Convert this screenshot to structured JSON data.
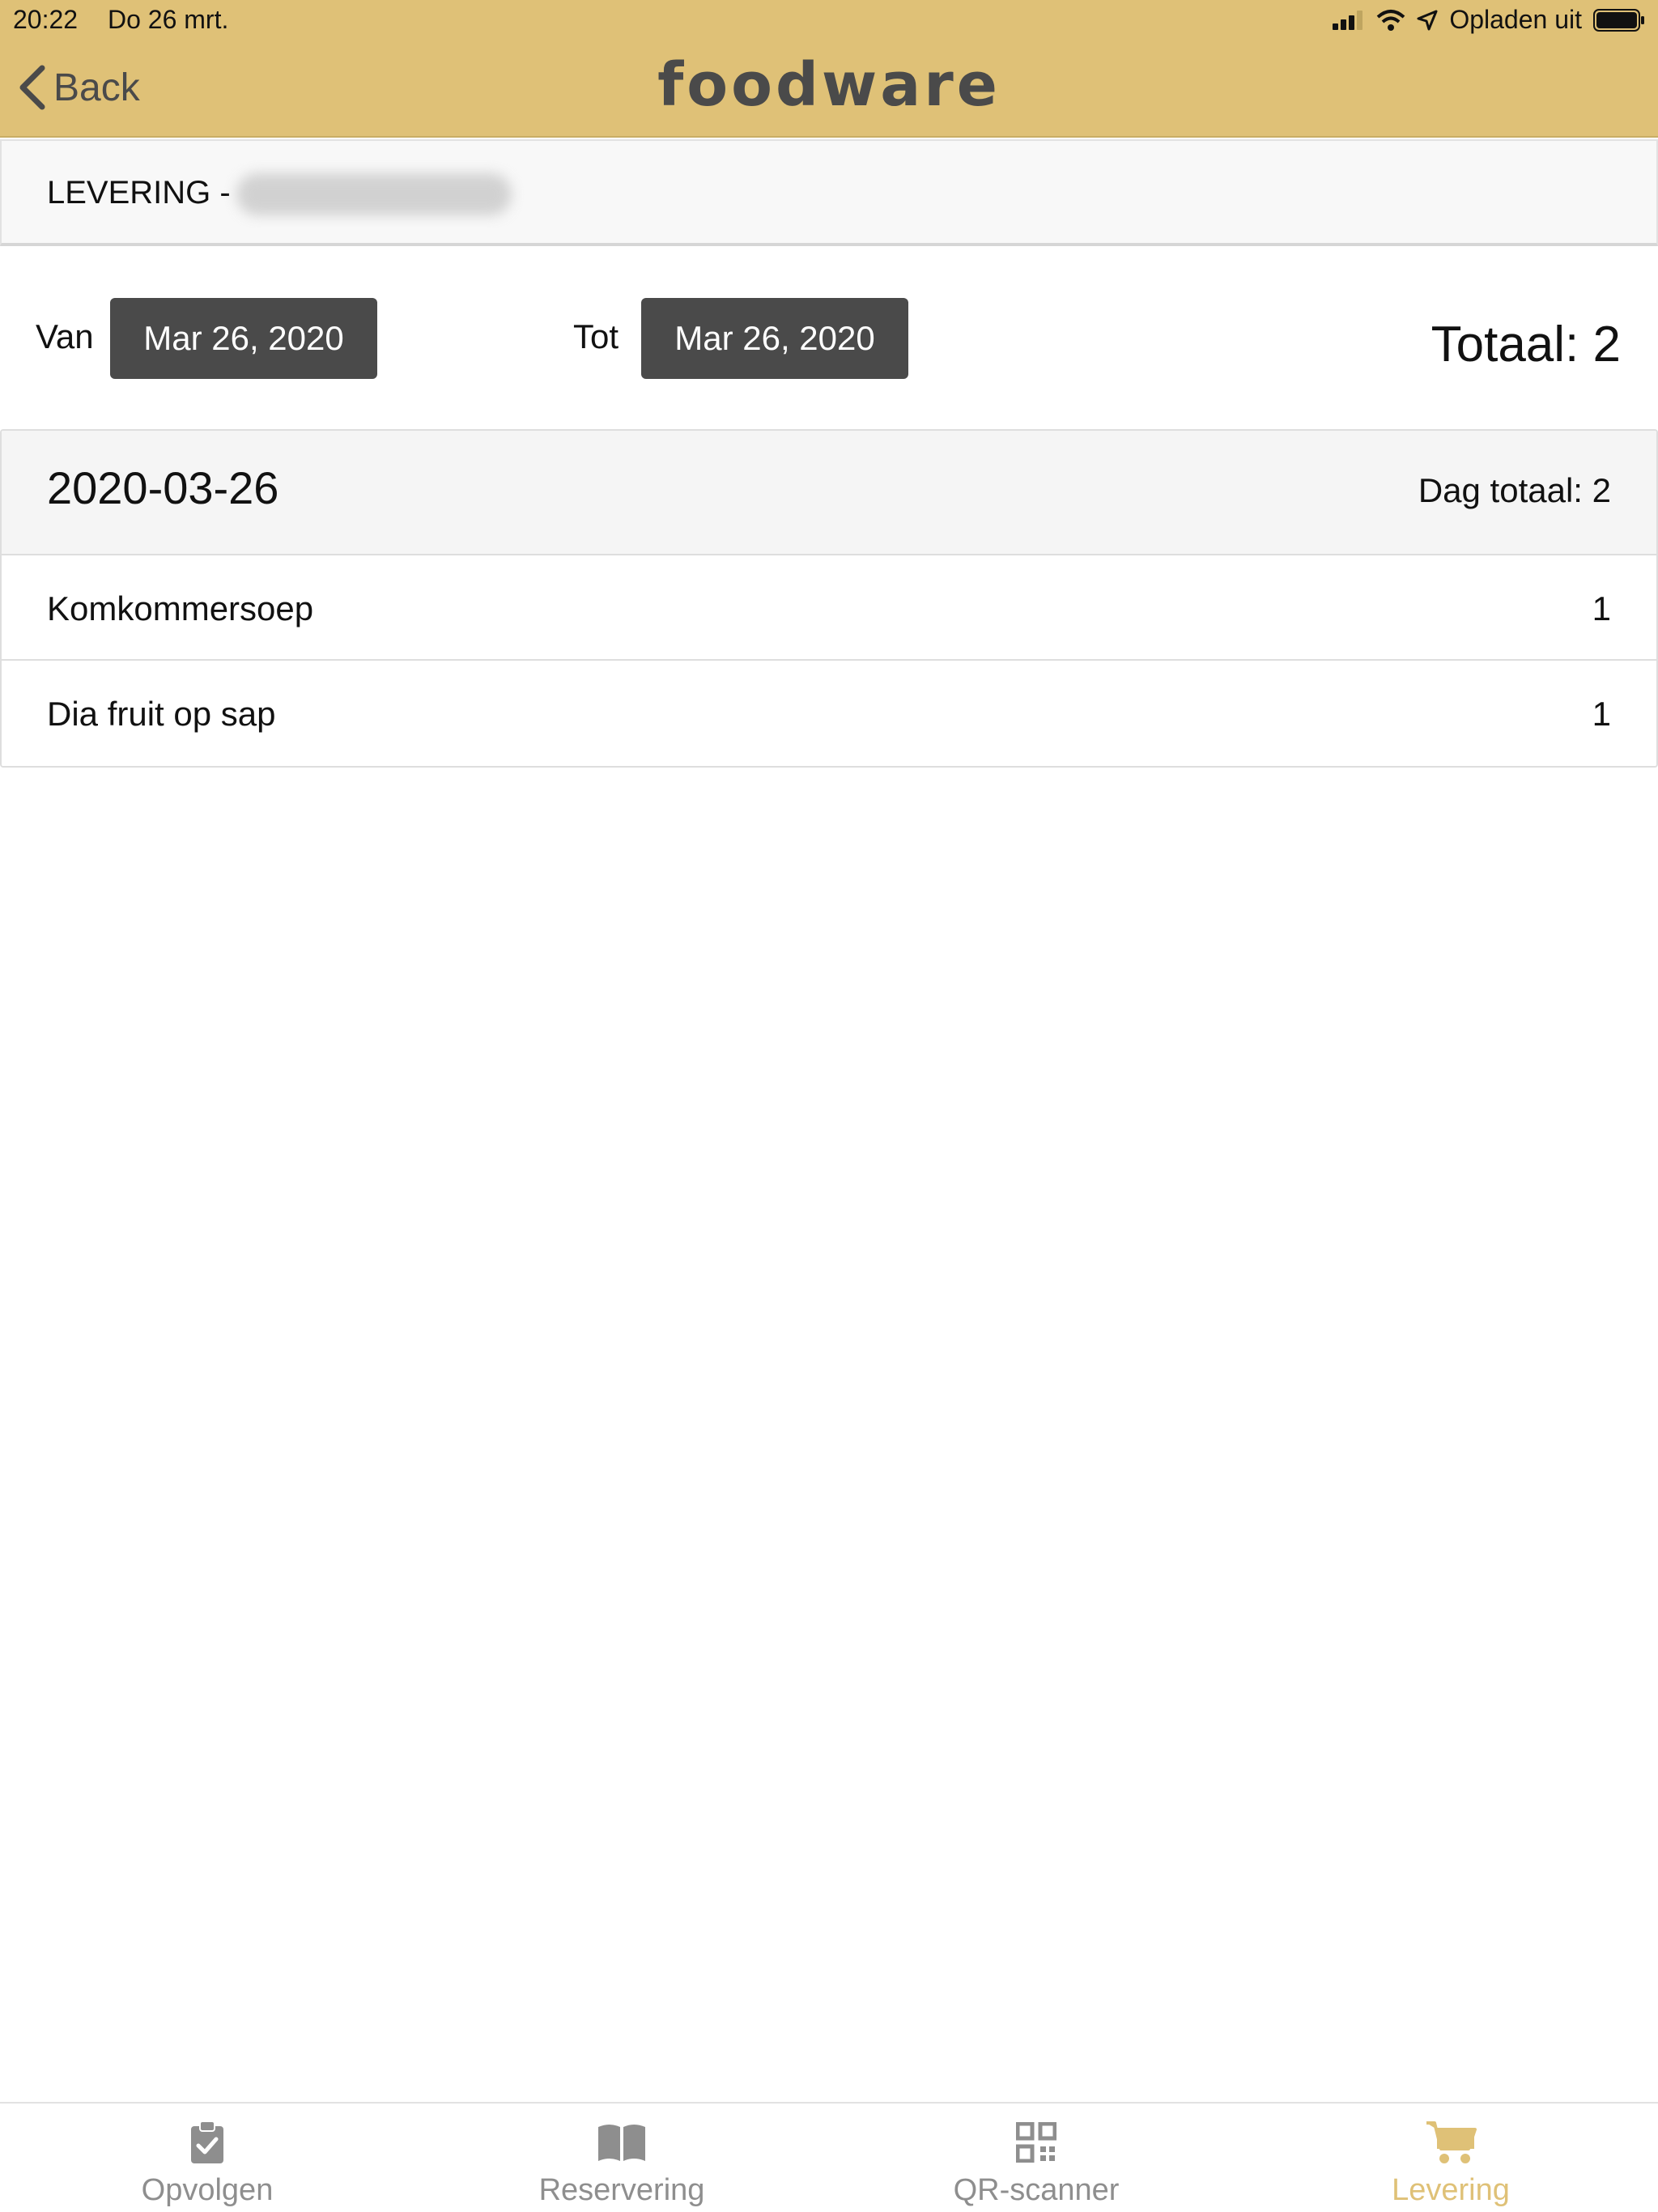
{
  "status_bar": {
    "time": "20:22",
    "date": "Do 26 mrt.",
    "charging": "Opladen uit"
  },
  "header": {
    "back_label": "Back",
    "logo": "foodware"
  },
  "title_bar": {
    "title": "LEVERING -"
  },
  "filter": {
    "from_label": "Van",
    "from_date": "Mar 26, 2020",
    "to_label": "Tot",
    "to_date": "Mar 26, 2020",
    "total": "Totaal: 2"
  },
  "day": {
    "date": "2020-03-26",
    "day_total": "Dag totaal: 2",
    "items": [
      {
        "name": "Komkommersoep",
        "qty": "1"
      },
      {
        "name": "Dia fruit op sap",
        "qty": "1"
      }
    ]
  },
  "tabs": [
    {
      "label": "Opvolgen",
      "icon": "clipboard-check-icon",
      "active": false
    },
    {
      "label": "Reservering",
      "icon": "open-book-icon",
      "active": false
    },
    {
      "label": "QR-scanner",
      "icon": "qr-code-icon",
      "active": false
    },
    {
      "label": "Levering",
      "icon": "shopping-cart-icon",
      "active": true
    }
  ],
  "colors": {
    "header_bg": "#dfc177",
    "accent": "#dfc177",
    "date_button_bg": "#4a4a4a",
    "tab_inactive": "#8e8e8e"
  }
}
